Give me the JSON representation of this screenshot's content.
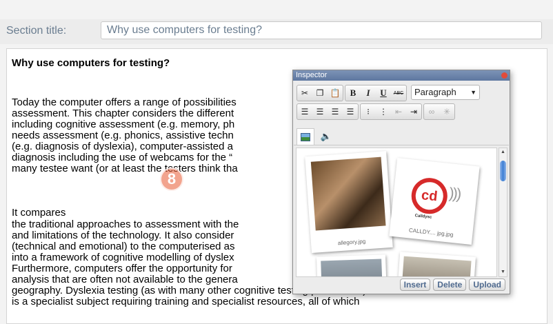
{
  "section": {
    "label": "Section title:",
    "value": "Why use computers for testing?"
  },
  "document": {
    "heading": "Why use computers for testing?",
    "paragraph1": [
      "Today the computer offers a range of possibilities",
      "assessment. This chapter considers the different",
      "including cognitive assessment (e.g. memory, ph",
      "needs assessment (e.g. phonics, assistive techn",
      "(e.g. diagnosis of dyslexia), computer-assisted a",
      "diagnosis including the use of webcams for the “",
      "many testee want (or at least the testers think tha"
    ],
    "paragraph2_title": "It compares",
    "paragraph3": [
      "the traditional approaches to assessment with the",
      "and limitations of the technology. It also consider",
      "(technical and emotional) to the computerised as",
      "into a framework of cognitive modelling of dyslex",
      "Furthermore, computers offer the opportunity for",
      "analysis that are often not available to the genera",
      "geography. Dyslexia testing (as with many other cognitive testing procedures)",
      "is a specialist subject requiring training and specialist resources, all of which"
    ]
  },
  "badge": {
    "number": "8"
  },
  "inspector": {
    "title": "Inspector",
    "format_select": "Paragraph",
    "toolbar": {
      "bold": "B",
      "italic": "I",
      "underline": "U",
      "strike": "ABC"
    },
    "tabs": [
      "image-tab",
      "audio-tab"
    ],
    "gallery": [
      {
        "caption": "allegory.jpg"
      },
      {
        "caption": "CALLDY.... jpg.jpg",
        "logo_text": "cd",
        "brand": "Calldysc"
      }
    ],
    "buttons": {
      "insert": "Insert",
      "delete": "Delete",
      "upload": "Upload"
    }
  },
  "colors": {
    "label_text": "#6a7d90",
    "inspector_title_bar": "#5e77a0",
    "close_dot": "#e04b3a",
    "badge": "#e85a32",
    "logo_red": "#d62a2a",
    "button_text": "#4f6a8f"
  }
}
